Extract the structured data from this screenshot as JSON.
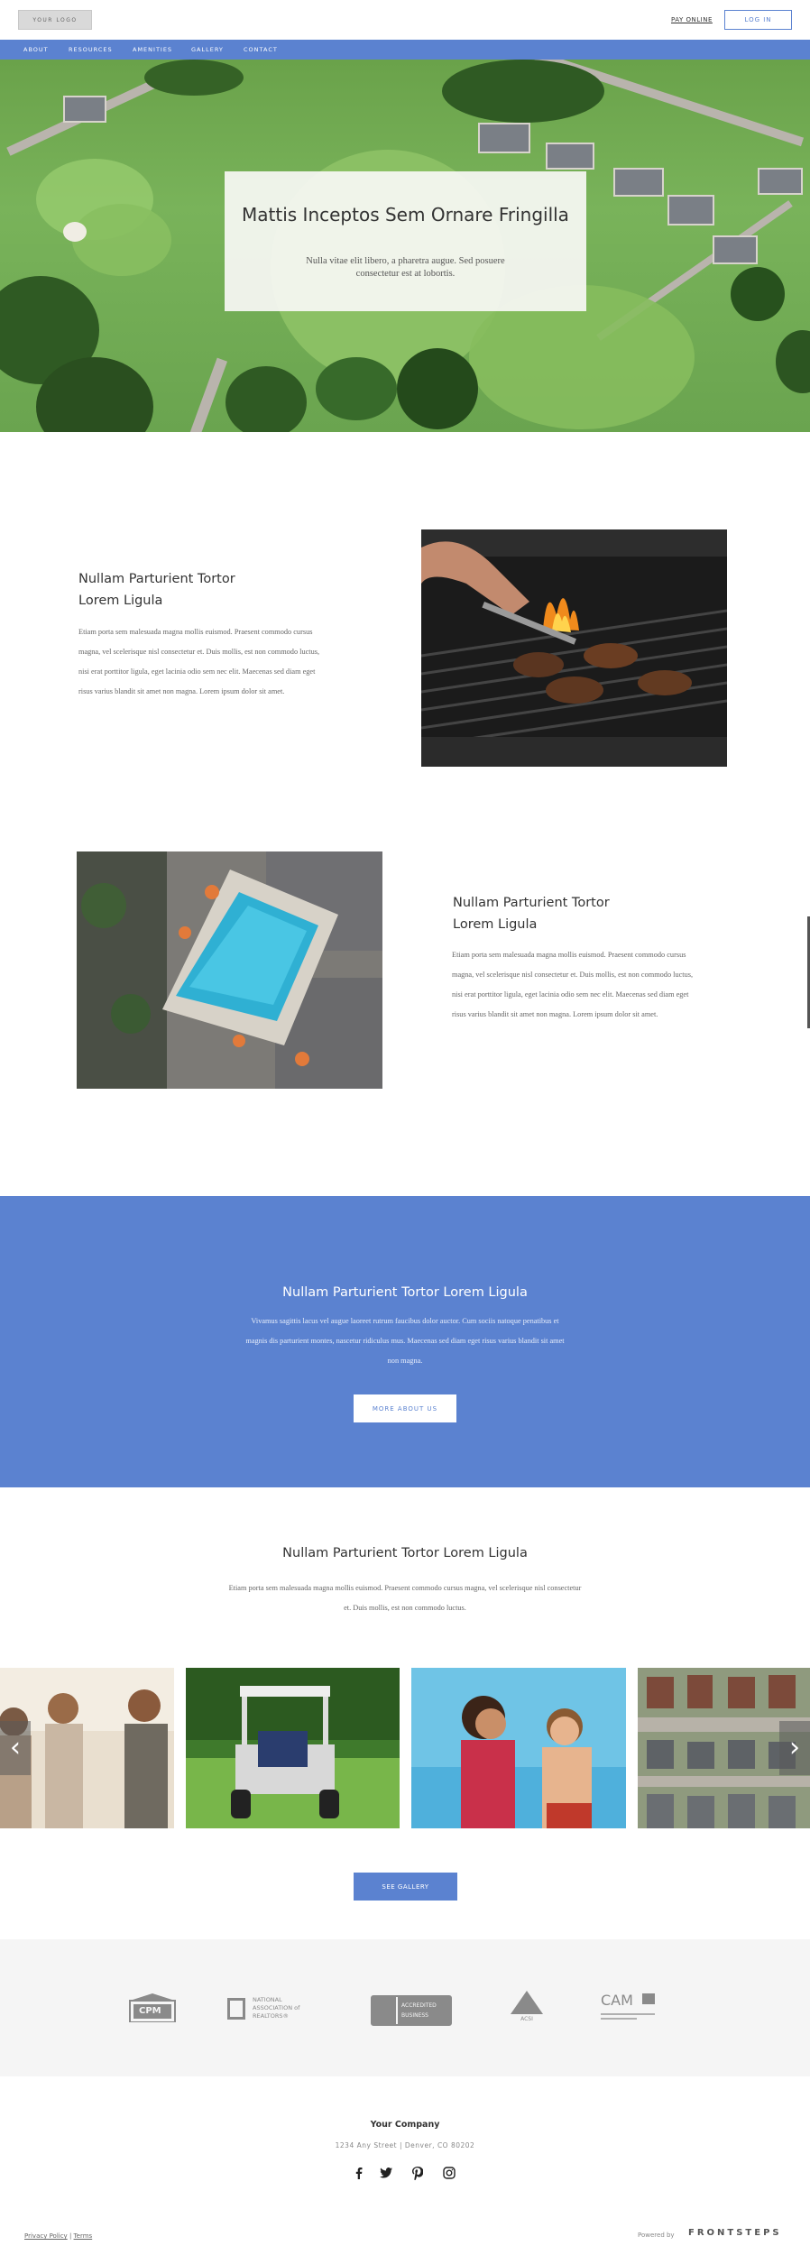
{
  "header": {
    "logo_text": "YOUR LOGO",
    "pay_online": "PAY ONLINE",
    "login": "LOG IN"
  },
  "nav": {
    "items": [
      "ABOUT",
      "RESOURCES",
      "AMENITIES",
      "GALLERY",
      "CONTACT"
    ]
  },
  "hero": {
    "title": "Mattis Inceptos Sem Ornare Fringilla",
    "subtitle": "Nulla vitae elit libero, a pharetra augue. Sed posuere consectetur est at lobortis."
  },
  "features": [
    {
      "title": "Nullam Parturient Tortor Lorem Ligula",
      "body": "Etiam porta sem malesuada magna mollis euismod. Praesent commodo cursus magna, vel scelerisque nisl consectetur et. Duis mollis, est non commodo luctus, nisi erat porttitor ligula, eget lacinia odio sem nec elit. Maecenas sed diam eget risus varius blandit sit amet non magna. Lorem ipsum dolor sit amet.",
      "image": "grill-photo"
    },
    {
      "title": "Nullam Parturient Tortor Lorem Ligula",
      "body": "Etiam porta sem malesuada magna mollis euismod. Praesent commodo cursus magna, vel scelerisque nisl consectetur et. Duis mollis, est non commodo luctus, nisi erat porttitor ligula, eget lacinia odio sem nec elit. Maecenas sed diam eget risus varius blandit sit amet non magna. Lorem ipsum dolor sit amet.",
      "image": "pool-photo"
    }
  ],
  "band": {
    "title": "Nullam Parturient Tortor Lorem Ligula",
    "body": "Vivamus sagittis lacus vel augue laoreet rutrum faucibus dolor auctor. Cum sociis natoque penatibus et magnis dis parturient montes, nascetur ridiculus mus. Maecenas sed diam eget risus varius blandit sit amet non magna.",
    "button": "MORE ABOUT US"
  },
  "gallery": {
    "title": "Nullam Parturient Tortor Lorem Ligula",
    "body": "Etiam porta sem malesuada magna mollis euismod. Praesent commodo cursus magna, vel scelerisque nisl consectetur et. Duis mollis, est non commodo luctus.",
    "button": "SEE GALLERY",
    "prev_glyph": "‹",
    "next_glyph": "›"
  },
  "logos": {
    "items": [
      {
        "name": "irem-logo",
        "text": "CPM"
      },
      {
        "name": "realtor-logo",
        "text_top": "NATIONAL",
        "text_mid": "ASSOCIATION of",
        "text_bot": "REALTORS®"
      },
      {
        "name": "bbb-logo",
        "text_top": "ACCREDITED",
        "text_bot": "BUSINESS"
      },
      {
        "name": "acsi-logo",
        "text": "ACSI"
      },
      {
        "name": "cam-logo",
        "text": "CAM"
      }
    ]
  },
  "footer": {
    "company": "Your Company",
    "address": "1234 Any Street  |  Denver, CO 80202",
    "privacy": "Privacy Policy",
    "separator": "|",
    "terms": "Terms",
    "powered_by": "Powered by",
    "brand": "FRONTSTEPS"
  },
  "colors": {
    "accent": "#5b82d0",
    "text_dark": "#333333",
    "logo_strip_bg": "#f5f5f5"
  }
}
